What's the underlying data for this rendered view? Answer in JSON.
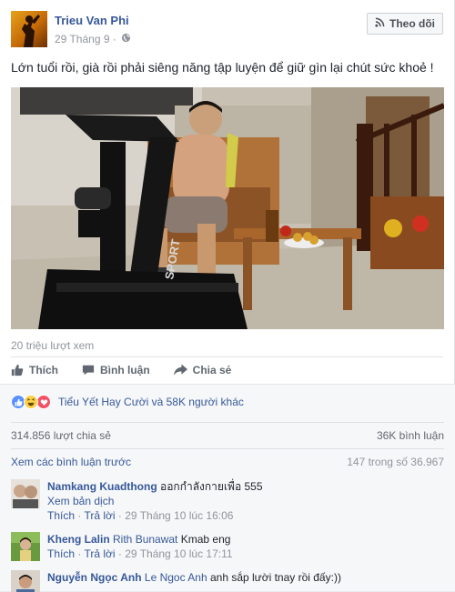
{
  "post": {
    "author": "Trieu Van Phi",
    "date": "29 Tháng 9 ·",
    "follow_label": "Theo dõi",
    "caption": "Lớn tuổi rồi, già rồi phải siêng năng tập luyện để giữ gìn lại chút sức khoẻ !",
    "video_brand_text": "SPORT",
    "views": "20 triệu lượt xem"
  },
  "actions": {
    "like": "Thích",
    "comment": "Bình luận",
    "share": "Chia sẻ"
  },
  "reactions": {
    "text": "Tiểu Yết Hay Cười và 58K người khác",
    "types": [
      "like-icon",
      "haha-icon",
      "love-icon"
    ]
  },
  "counts": {
    "shares": "314.856 lượt chia sẻ",
    "comments": "36K bình luận"
  },
  "comments_header": {
    "prev_link": "Xem các bình luận trước",
    "count": "147 trong số 36.967"
  },
  "comments": [
    {
      "name": "Namkang Kuadthong",
      "text": "ออกกำลังกายเพื่อ 555",
      "translate": "Xem bản dịch",
      "like": "Thích",
      "reply": "Trả lời",
      "time": "29 Tháng 10 lúc 16:06"
    },
    {
      "name": "Kheng Lalin",
      "tag": "Rith Bunawat",
      "text": "Kmab eng",
      "like": "Thích",
      "reply": "Trả lời",
      "time": "29 Tháng 10 lúc 17:11"
    },
    {
      "name": "Nguyễn Ngọc Anh",
      "tag": "Le Ngoc Anh",
      "text": "anh sắp lười tnay rồi đấy:))"
    }
  ],
  "colors": {
    "link": "#365899",
    "muted": "#90949c",
    "like_blue": "#5890ff",
    "love_red": "#f25268",
    "haha_yellow": "#fcd04a"
  }
}
